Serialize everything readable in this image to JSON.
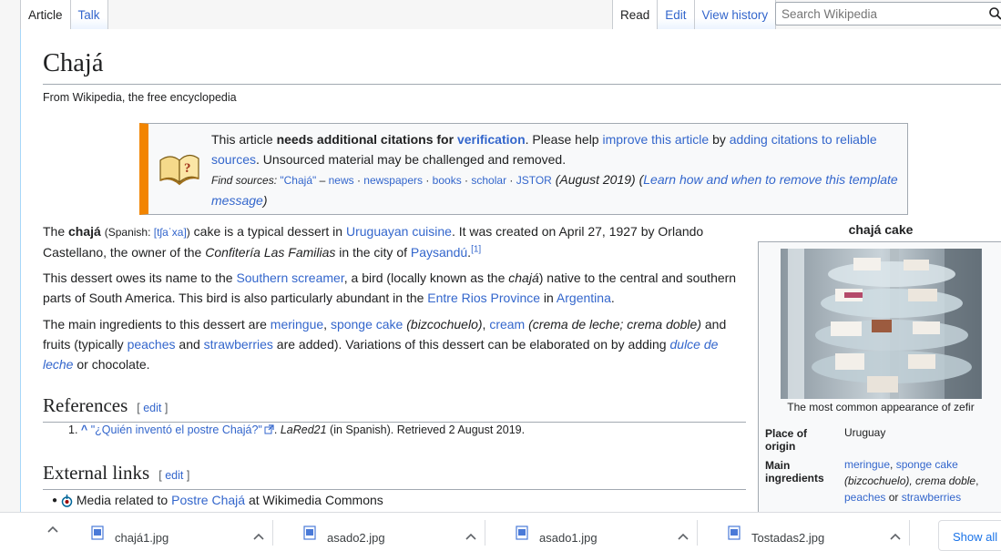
{
  "tabs": {
    "left": [
      "Article",
      "Talk"
    ],
    "right": [
      "Read",
      "Edit",
      "View history"
    ]
  },
  "search": {
    "placeholder": "Search Wikipedia"
  },
  "page": {
    "title": "Chajá",
    "tagline": "From Wikipedia, the free encyclopedia"
  },
  "ambox": {
    "t1": "This article ",
    "t2": "needs additional citations for ",
    "t3": "verification",
    "t4": ". Please help ",
    "t5": "improve this article",
    "t6": " by ",
    "t7": "adding citations to reliable sources",
    "t8": ". Unsourced material may be challenged and removed.",
    "fs_label": "Find sources:",
    "fs_q": "\"Chajá\"",
    "fs_dash": " – ",
    "fs_news": "news",
    "fs_newspapers": "newspapers",
    "fs_books": "books",
    "fs_scholar": "scholar",
    "fs_jstor": "JSTOR",
    "fs_date": "(August 2019)",
    "fs_learn": "Learn how and when to remove this template message"
  },
  "p1": {
    "a": "The ",
    "b": "chajá",
    "c": "Spanish: ",
    "d": "[tʃaˈxa]",
    "e": " cake is a typical dessert in ",
    "f": "Uruguayan cuisine",
    "g": ". It was created on April 27, 1927 by Orlando Castellano, the owner of the ",
    "h": "Confitería Las Familias",
    "i": " in the city of ",
    "j": "Paysandú",
    "k": "[1]"
  },
  "p2": {
    "a": "This dessert owes its name to the ",
    "b": "Southern screamer",
    "c": ", a bird (locally known as the ",
    "d": "chajá",
    "e": ") native to the central and southern parts of South America. This bird is also particularly abundant in the ",
    "f": "Entre Rios Province",
    "g": " in ",
    "h": "Argentina",
    "i": "."
  },
  "p3": {
    "a": "The main ingredients to this dessert are ",
    "b": "meringue",
    "c": ", ",
    "d": "sponge cake",
    "e": "bizcochuelo",
    "f": ", ",
    "g": "cream",
    "h": "crema de leche; crema doble",
    "i": " and fruits (typically ",
    "j": "peaches",
    "k": " and ",
    "l": "strawberries",
    "m": " are added). Variations of this dessert can be elaborated on by adding ",
    "n": "dulce de leche",
    "o": " or chocolate."
  },
  "sections": {
    "references": "References",
    "external": "External links",
    "edit": "edit"
  },
  "ref1": {
    "num": "1.",
    "caret": "^",
    "title": "\"¿Quién inventó el postre Chajá?\"",
    "site": "LaRed21",
    "rest": " (in Spanish). Retrieved 2 August 2019."
  },
  "ext1": {
    "a": "Media related to ",
    "b": "Postre Chajá",
    "c": " at Wikimedia Commons"
  },
  "infobox": {
    "caption": "chajá cake",
    "image_caption": "The most common appearance of zefir",
    "origin_label": "Place of origin",
    "origin_value": "Uruguay",
    "ingredients_label": "Main ingredients",
    "ing_meringue": "meringue",
    "ing_sponge": "sponge cake",
    "ing_bizcochuelo": "(bizcochuelo)",
    "ing_crema": ", crema doble",
    "ing_peaches": "peaches",
    "ing_or": " or ",
    "ing_strawberries": "strawberries"
  },
  "downloads": {
    "files": [
      "chajá1.jpg",
      "asado2.jpg",
      "asado1.jpg",
      "Tostadas2.jpg"
    ],
    "show_all": "Show all"
  }
}
